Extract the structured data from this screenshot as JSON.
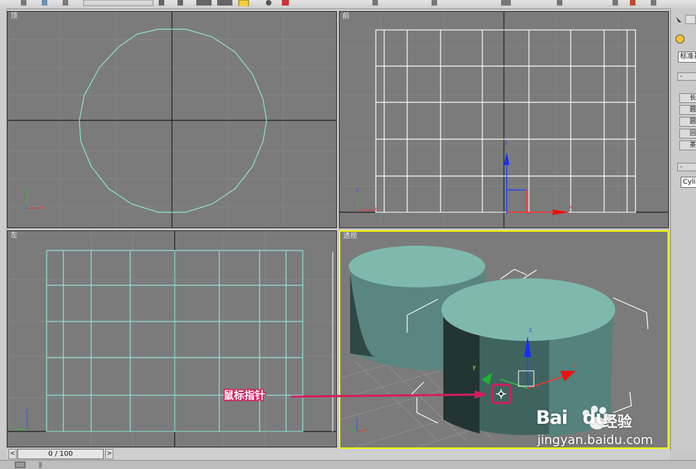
{
  "viewports": {
    "top": {
      "label": "顶"
    },
    "front": {
      "label": "前"
    },
    "left": {
      "label": "左"
    },
    "perspective": {
      "label": "透视"
    }
  },
  "axes": {
    "x": "x",
    "y": "y",
    "z": "z"
  },
  "command_panel": {
    "dropdown_value": "标准基",
    "rollout_minus": "-",
    "buttons": [
      "长",
      "圆",
      "圆",
      "回",
      "茶"
    ],
    "name_field": "Cylir"
  },
  "timeline": {
    "position_label": "0 / 100",
    "prev_arrow": "<",
    "next_arrow": ">"
  },
  "annotation": {
    "label": "鼠标指针",
    "color": "#d81b5e"
  },
  "watermark": {
    "brand": "Bai",
    "brand_suffix": "du",
    "cn": "经验",
    "url": "jingyan.baidu.com"
  },
  "colors": {
    "viewport_bg": "#7b7b7b",
    "active_border": "#f5f500",
    "wire_cyan": "#8fe6d6",
    "wire_white": "#ffffff",
    "cylinder_top": "#7fb9ad",
    "cylinder_side": "#3f6460"
  }
}
